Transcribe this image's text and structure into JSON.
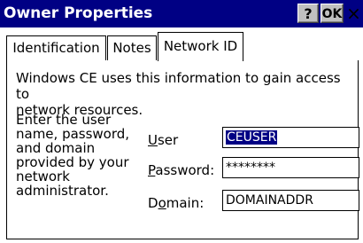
{
  "window": {
    "title": "Owner Properties",
    "help_label": "?",
    "ok_label": "OK",
    "close_label": "×"
  },
  "tabs": [
    {
      "label": "Identification",
      "active": false
    },
    {
      "label": "Notes",
      "active": false
    },
    {
      "label": "Network ID",
      "active": true
    }
  ],
  "content": {
    "intro_line1": "Windows CE uses this information to gain access to",
    "intro_line2": "network resources.",
    "instructions": [
      "Enter the user",
      "name, password,",
      "and domain",
      "provided by your",
      "network",
      "administrator."
    ]
  },
  "fields": {
    "user": {
      "label_accel": "U",
      "label_rest": "ser",
      "value": "CEUSER"
    },
    "password": {
      "label_accel": "P",
      "label_rest": "assword:",
      "value": "********"
    },
    "domain": {
      "label_pre": "D",
      "label_accel": "o",
      "label_rest": "main:",
      "value": "DOMAINADDR"
    }
  },
  "colors": {
    "titlebar": "#000084",
    "selection": "#000084",
    "button_face": "#c0c0c0"
  }
}
